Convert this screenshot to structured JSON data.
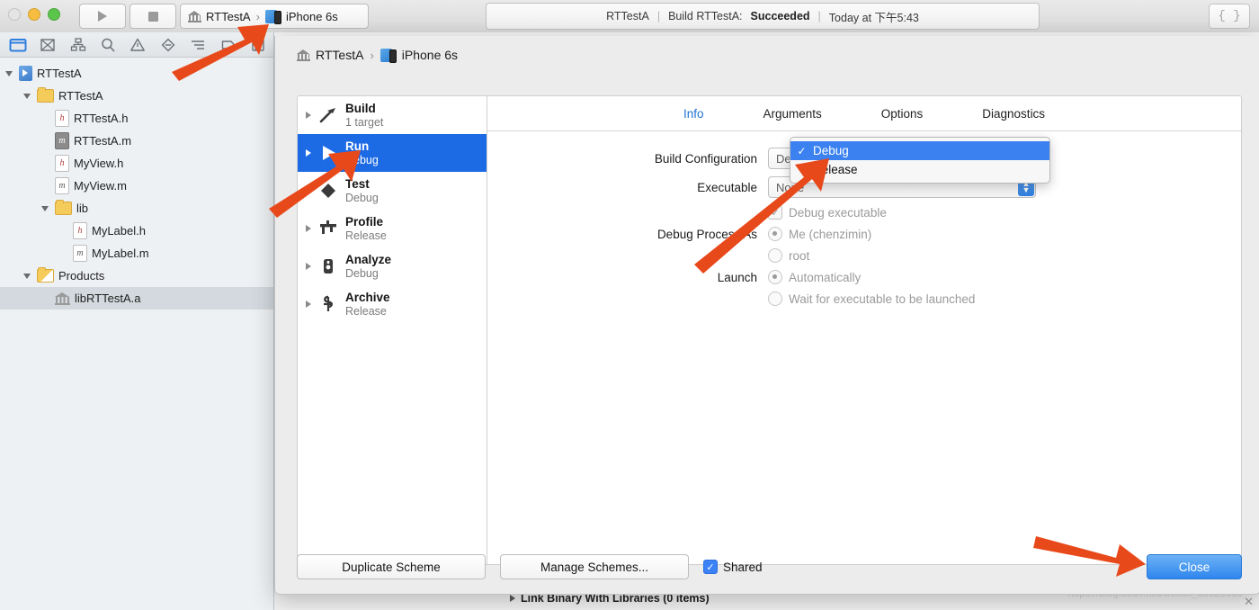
{
  "toolbar": {
    "run_icon": "play-icon",
    "stop_icon": "stop-icon",
    "scheme_project": "RTTestA",
    "scheme_separator": "›",
    "scheme_destination": "iPhone 6s",
    "assistant_label": "{ }",
    "status": {
      "project": "RTTestA",
      "sep": "|",
      "action": "Build RTTestA:",
      "result": "Succeeded",
      "time": "Today at 下午5:43"
    }
  },
  "navigator": {
    "tabs": [
      {
        "name": "project-navigator",
        "icon": "folder-icon",
        "active": true
      },
      {
        "name": "source-control-navigator",
        "icon": "crossed-box-icon",
        "active": false
      },
      {
        "name": "symbol-navigator",
        "icon": "hierarchy-icon",
        "active": false
      },
      {
        "name": "find-navigator",
        "icon": "search-icon",
        "active": false
      },
      {
        "name": "issue-navigator",
        "icon": "warning-triangle-icon",
        "active": false
      },
      {
        "name": "test-navigator",
        "icon": "diamond-minus-icon",
        "active": false
      },
      {
        "name": "debug-navigator",
        "icon": "debug-lines-icon",
        "active": false
      },
      {
        "name": "breakpoint-navigator",
        "icon": "breakpoint-arrow-icon",
        "active": false
      },
      {
        "name": "report-navigator",
        "icon": "report-icon",
        "active": false
      }
    ],
    "tree": [
      {
        "label": "RTTestA",
        "icon": "xcode-project-icon",
        "indent": 0,
        "expanded": true,
        "selected": false
      },
      {
        "label": "RTTestA",
        "icon": "folder-icon",
        "indent": 1,
        "expanded": true,
        "selected": false
      },
      {
        "label": "RTTestA.h",
        "icon": "header-file-icon",
        "indent": 2,
        "expanded": null,
        "selected": false
      },
      {
        "label": "RTTestA.m",
        "icon": "impl-file-icon",
        "indent": 2,
        "expanded": null,
        "selected": false
      },
      {
        "label": "MyView.h",
        "icon": "header-file-icon",
        "indent": 2,
        "expanded": null,
        "selected": false
      },
      {
        "label": "MyView.m",
        "icon": "source-file-icon",
        "indent": 2,
        "expanded": null,
        "selected": false
      },
      {
        "label": "lib",
        "icon": "folder-icon",
        "indent": 2,
        "expanded": true,
        "selected": false
      },
      {
        "label": "MyLabel.h",
        "icon": "header-file-icon",
        "indent": 3,
        "expanded": null,
        "selected": false
      },
      {
        "label": "MyLabel.m",
        "icon": "source-file-icon",
        "indent": 3,
        "expanded": null,
        "selected": false
      },
      {
        "label": "Products",
        "icon": "products-folder-icon",
        "indent": 1,
        "expanded": true,
        "selected": false
      },
      {
        "label": "libRTTestA.a",
        "icon": "static-library-icon",
        "indent": 2,
        "expanded": null,
        "selected": true
      }
    ]
  },
  "editor_background": {
    "link_binary_row": "Link Binary With Libraries (0 items)",
    "watermark": "https://blog.csdn.net/weixin_39629360",
    "watermark_close": "✕"
  },
  "scheme_sheet": {
    "breadcrumb": {
      "scheme": "RTTestA",
      "separator": "›",
      "destination": "iPhone 6s"
    },
    "actions": [
      {
        "title": "Build",
        "subtitle": "1 target",
        "icon": "hammer-icon",
        "selected": false
      },
      {
        "title": "Run",
        "subtitle": "Debug",
        "icon": "play-icon",
        "selected": true
      },
      {
        "title": "Test",
        "subtitle": "Debug",
        "icon": "test-diamond-icon",
        "selected": false
      },
      {
        "title": "Profile",
        "subtitle": "Release",
        "icon": "caliper-icon",
        "selected": false
      },
      {
        "title": "Analyze",
        "subtitle": "Debug",
        "icon": "analyze-icon",
        "selected": false
      },
      {
        "title": "Archive",
        "subtitle": "Release",
        "icon": "archive-icon",
        "selected": false
      }
    ],
    "tabs": [
      {
        "label": "Info",
        "active": true
      },
      {
        "label": "Arguments",
        "active": false
      },
      {
        "label": "Options",
        "active": false
      },
      {
        "label": "Diagnostics",
        "active": false
      }
    ],
    "info_form": {
      "build_configuration_label": "Build Configuration",
      "build_configuration_value": "Debug",
      "executable_label": "Executable",
      "executable_value": "None",
      "debug_executable_label": "Debug executable",
      "debug_executable_checked": true,
      "debug_process_as_label": "Debug Process As",
      "debug_process_options": [
        {
          "label": "Me (chenzimin)",
          "selected": true
        },
        {
          "label": "root",
          "selected": false
        }
      ],
      "launch_label": "Launch",
      "launch_options": [
        {
          "label": "Automatically",
          "selected": true
        },
        {
          "label": "Wait for executable to be launched",
          "selected": false
        }
      ]
    },
    "config_menu": {
      "items": [
        {
          "label": "Debug",
          "checked": true,
          "highlighted": true
        },
        {
          "label": "Release",
          "checked": false,
          "highlighted": false
        }
      ],
      "check_glyph": "✓"
    },
    "footer": {
      "duplicate_scheme": "Duplicate Scheme",
      "manage_schemes": "Manage Schemes...",
      "shared_label": "Shared",
      "shared_checked": true,
      "close_label": "Close",
      "check_glyph": "✓"
    }
  },
  "annotations": {
    "arrow_color": "#e8491b",
    "arrows": [
      {
        "name": "arrow-to-scheme-selector"
      },
      {
        "name": "arrow-to-run-action"
      },
      {
        "name": "arrow-to-build-configuration-menu"
      },
      {
        "name": "arrow-to-close-button"
      }
    ]
  }
}
